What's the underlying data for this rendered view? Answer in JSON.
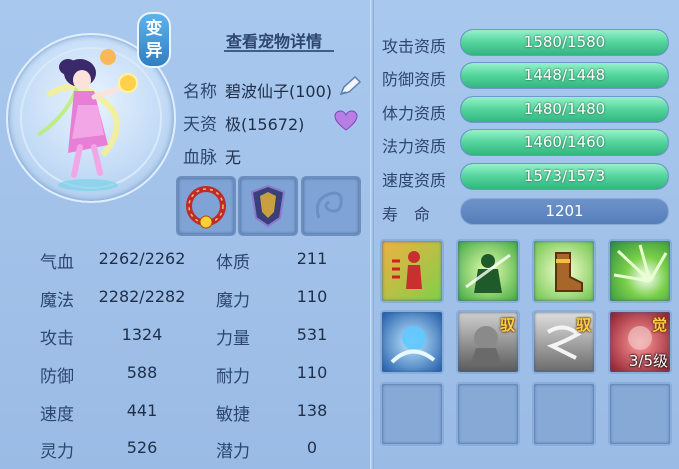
{
  "transform_badge": [
    "变",
    "异"
  ],
  "detail_link": "查看宠物详情",
  "info": {
    "name_label": "名称",
    "name_value": "碧波仙子(100)",
    "talent_label": "天资",
    "talent_value": "极(15672)",
    "bloodline_label": "血脉",
    "bloodline_value": "无"
  },
  "stats": [
    {
      "label": "气血",
      "value": "2262/2262",
      "label2": "体质",
      "value2": "211"
    },
    {
      "label": "魔法",
      "value": "2282/2282",
      "label2": "魔力",
      "value2": "110"
    },
    {
      "label": "攻击",
      "value": "1324",
      "label2": "力量",
      "value2": "531"
    },
    {
      "label": "防御",
      "value": "588",
      "label2": "耐力",
      "value2": "110"
    },
    {
      "label": "速度",
      "value": "441",
      "label2": "敏捷",
      "value2": "138"
    },
    {
      "label": "灵力",
      "value": "526",
      "label2": "潜力",
      "value2": "0"
    }
  ],
  "aptitudes": [
    {
      "label": "攻击资质",
      "text": "1580/1580",
      "fill": 1.0
    },
    {
      "label": "防御资质",
      "text": "1448/1448",
      "fill": 1.0
    },
    {
      "label": "体力资质",
      "text": "1480/1480",
      "fill": 1.0
    },
    {
      "label": "法力资质",
      "text": "1460/1460",
      "fill": 1.0
    },
    {
      "label": "速度资质",
      "text": "1573/1573",
      "fill": 1.0
    }
  ],
  "lifespan": {
    "label": "寿　命",
    "value": "1201"
  },
  "skills": {
    "tag1": "驭",
    "tag2": "驭",
    "tag3": "觉",
    "level": "3/5级"
  },
  "colors": {
    "bar_green": "#53d49c",
    "panel_bg": "#a9c8ee",
    "text_dark": "#2d4670"
  }
}
